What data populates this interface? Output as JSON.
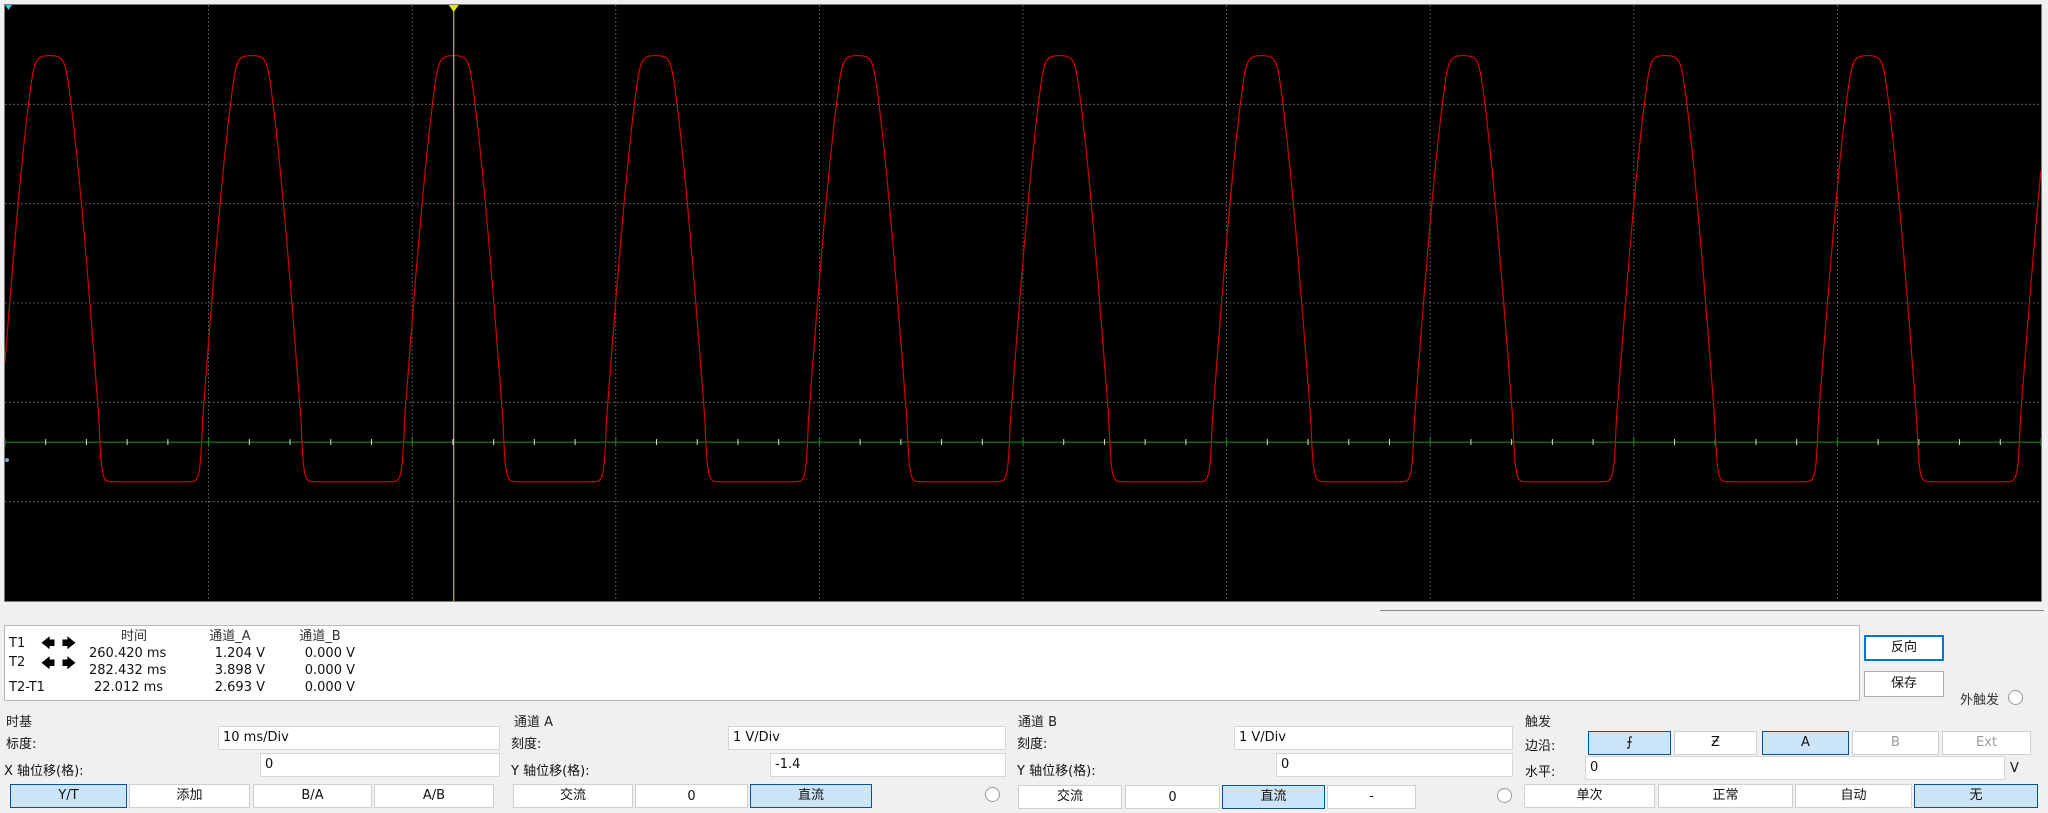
{
  "colors": {
    "screen_bg": "#000000",
    "grid": "#8a8a8a",
    "trace_a": "#d40000",
    "zero_line": "#1f8f1f",
    "cursor": "#e5e500",
    "accent": "#cce4f7"
  },
  "cursors": {
    "t1_label": "T1",
    "t2_label": "T2",
    "diff_label": "T2-T1",
    "left_arrow": "🡄",
    "right_arrow": "🡆",
    "headers": {
      "time": "时间",
      "ch_a": "通道_A",
      "ch_b": "通道_B"
    },
    "rows": [
      {
        "time": "260.420 ms",
        "ch_a": "1.204 V",
        "ch_b": "0.000 V"
      },
      {
        "time": "282.432 ms",
        "ch_a": "3.898 V",
        "ch_b": "0.000 V"
      },
      {
        "time": "22.012 ms",
        "ch_a": "2.693 V",
        "ch_b": "0.000 V"
      }
    ]
  },
  "side": {
    "invert_label": "反向",
    "save_label": "保存",
    "external_trigger_label": "外触发"
  },
  "timebase": {
    "title": "时基",
    "scale_label": "标度:",
    "scale_value": "10 ms/Div",
    "xoffset_label": "X 轴位移(格):",
    "xoffset_value": "0",
    "buttons": [
      "Y/T",
      "添加",
      "B/A",
      "A/B"
    ]
  },
  "channel_a": {
    "title": "通道 A",
    "scale_label": "刻度:",
    "scale_value": "1  V/Div",
    "yoffset_label": "Y 轴位移(格):",
    "yoffset_value": "-1.4",
    "ac_label": "交流",
    "zero_label": "0",
    "dc_label": "直流"
  },
  "channel_b": {
    "title": "通道 B",
    "scale_label": "刻度:",
    "scale_value": "1  V/Div",
    "yoffset_label": "Y 轴位移(格):",
    "yoffset_value": "0",
    "ac_label": "交流",
    "zero_label": "0",
    "dc_label": "直流",
    "dash_label": "-"
  },
  "trigger": {
    "title": "触发",
    "edge_label": "边沿:",
    "rising_edge_symbol": "⨍",
    "falling_edge_symbol": "Ƶ",
    "source_a": "A",
    "source_b": "B",
    "source_ext": "Ext",
    "level_label": "水平:",
    "level_value": "0",
    "level_unit": "V",
    "modes": [
      "单次",
      "正常",
      "自动",
      "无"
    ]
  },
  "chart_data": {
    "type": "line",
    "x_unit": "ms",
    "y_unit": "V",
    "divisions": {
      "x": 10,
      "y": 6
    },
    "time_per_div_ms": 10,
    "volts_per_div": 1,
    "xlim": [
      0,
      100
    ],
    "ylim": [
      -1.6,
      4.4
    ],
    "zero_level_v": 0,
    "series": [
      {
        "channel": "A",
        "period_ms": 9.92,
        "high_v": 3.9,
        "low_v": -0.4,
        "first_peak_ms": 2.2,
        "peak_times_ms": [
          2.2,
          12.12,
          22.04,
          31.96,
          41.88,
          51.8,
          61.72,
          71.64,
          81.56,
          91.48
        ]
      }
    ],
    "cursor_t_ms": 22.04
  }
}
